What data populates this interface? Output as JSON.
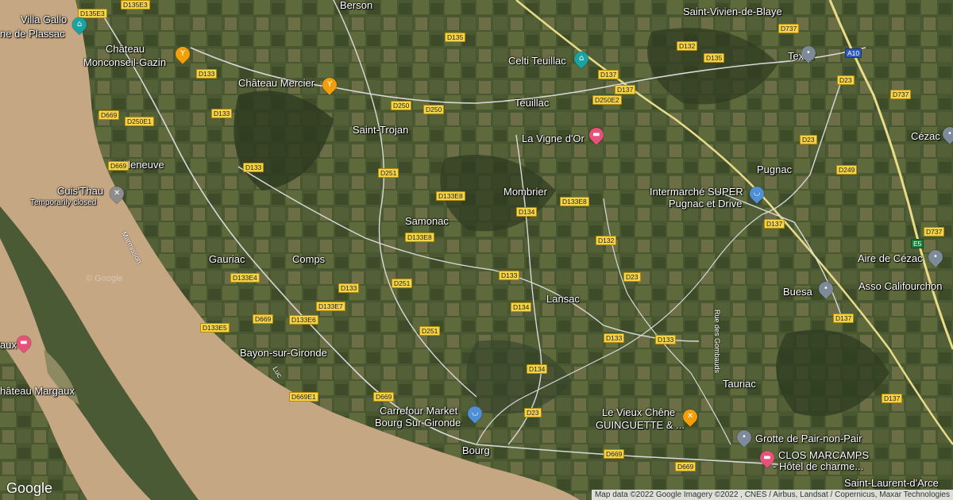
{
  "map": {
    "imagery": "satellite",
    "colors": {
      "river": "#c9aa86",
      "land": "#3f4e2c",
      "fields": "#6e7046",
      "road_major": "#e8dc8a",
      "road_minor": "#c8c8c8",
      "food_pin": "#f29f0a",
      "shop_pin": "#4f8fd6",
      "attraction_pin": "#1aa3a3",
      "hotel_pin": "#e8527a",
      "place_pin": "#7d8a99"
    }
  },
  "places": [
    {
      "text": "Villa Gallo",
      "cls": "place"
    },
    {
      "text": "ne de Plassac",
      "cls": "place"
    },
    {
      "text": "Saint-Vivien-de-Blaye",
      "cls": "place"
    },
    {
      "text": "Château",
      "cls": "place"
    },
    {
      "text": "Monconseil-Gazin",
      "cls": "place"
    },
    {
      "text": "Château Mercier",
      "cls": "place"
    },
    {
      "text": "Celti Teuillac",
      "cls": "place"
    },
    {
      "text": "Texier",
      "cls": "place"
    },
    {
      "text": "Teuillac",
      "cls": "place"
    },
    {
      "text": "Saint-Trojan",
      "cls": "place"
    },
    {
      "text": "La Vigne d'Or",
      "cls": "place"
    },
    {
      "text": "Cézac",
      "cls": "place"
    },
    {
      "text": "Villeneuve",
      "cls": "place"
    },
    {
      "text": "Pugnac",
      "cls": "place"
    },
    {
      "text": "Cuis'Thau",
      "cls": "place"
    },
    {
      "text": "Temporarily closed",
      "cls": "place small"
    },
    {
      "text": "Mombrier",
      "cls": "place"
    },
    {
      "text": "Intermarché SUPER",
      "cls": "place"
    },
    {
      "text": "Pugnac et Drive",
      "cls": "place"
    },
    {
      "text": "Samonac",
      "cls": "place"
    },
    {
      "text": "Gauriac",
      "cls": "place"
    },
    {
      "text": "Comps",
      "cls": "place"
    },
    {
      "text": "Aire de Cézac",
      "cls": "place"
    },
    {
      "text": "Asso Califourchon",
      "cls": "place"
    },
    {
      "text": "Buesa",
      "cls": "place"
    },
    {
      "text": "Lansac",
      "cls": "place"
    },
    {
      "text": "aux",
      "cls": "place"
    },
    {
      "text": "Bayon-sur-Gironde",
      "cls": "place"
    },
    {
      "text": "Tauriac",
      "cls": "place"
    },
    {
      "text": "hâteau Margaux",
      "cls": "place"
    },
    {
      "text": "Carrefour Market",
      "cls": "place"
    },
    {
      "text": "Bourg Sur Gironde",
      "cls": "place"
    },
    {
      "text": "Le Vieux Chêne",
      "cls": "place"
    },
    {
      "text": "GUINGUETTE & ...",
      "cls": "place"
    },
    {
      "text": "Grotte de Pair-non-Pair",
      "cls": "place"
    },
    {
      "text": "Bourg",
      "cls": "place"
    },
    {
      "text": "CLOS MARCAMPS",
      "cls": "place"
    },
    {
      "text": "- Hôtel de charme...",
      "cls": "place"
    },
    {
      "text": "Saint-Laurent-d'Arce",
      "cls": "place"
    },
    {
      "text": "Berson",
      "cls": "place"
    }
  ],
  "shields": [
    {
      "text": "D135E3"
    },
    {
      "text": "D135E3"
    },
    {
      "text": "D135"
    },
    {
      "text": "D737"
    },
    {
      "text": "D132"
    },
    {
      "text": "D135"
    },
    {
      "text": "A10",
      "cls": "shield blue"
    },
    {
      "text": "D133"
    },
    {
      "text": "D137"
    },
    {
      "text": "D137"
    },
    {
      "text": "D23"
    },
    {
      "text": "D669"
    },
    {
      "text": "D250E1"
    },
    {
      "text": "D133"
    },
    {
      "text": "D250"
    },
    {
      "text": "D250"
    },
    {
      "text": "D250E2"
    },
    {
      "text": "D737"
    },
    {
      "text": "D669"
    },
    {
      "text": "D133"
    },
    {
      "text": "D251"
    },
    {
      "text": "D23"
    },
    {
      "text": "D249"
    },
    {
      "text": "D133E8"
    },
    {
      "text": "D134"
    },
    {
      "text": "D133E8"
    },
    {
      "text": "D137"
    },
    {
      "text": "D133E8"
    },
    {
      "text": "D132"
    },
    {
      "text": "D737"
    },
    {
      "text": "E5",
      "cls": "shield green"
    },
    {
      "text": "D133E4"
    },
    {
      "text": "D133"
    },
    {
      "text": "D251"
    },
    {
      "text": "D133"
    },
    {
      "text": "D23"
    },
    {
      "text": "D133E7"
    },
    {
      "text": "D134"
    },
    {
      "text": "D669"
    },
    {
      "text": "D133E6"
    },
    {
      "text": "D137"
    },
    {
      "text": "D133E5"
    },
    {
      "text": "D251"
    },
    {
      "text": "D133"
    },
    {
      "text": "D133"
    },
    {
      "text": "D134"
    },
    {
      "text": "D669E1"
    },
    {
      "text": "D669"
    },
    {
      "text": "D137"
    },
    {
      "text": "D23"
    },
    {
      "text": "D669"
    },
    {
      "text": "D669"
    }
  ],
  "pins": [
    {
      "icon": "attraction-icon",
      "glyph": "⌂"
    },
    {
      "icon": "wine-icon",
      "glyph": "Y"
    },
    {
      "icon": "wine-icon",
      "glyph": "Y"
    },
    {
      "icon": "attraction-icon",
      "glyph": "⌂"
    },
    {
      "icon": "place-icon",
      "glyph": "•"
    },
    {
      "icon": "bed-icon",
      "glyph": "▬"
    },
    {
      "icon": "place-icon",
      "glyph": "•"
    },
    {
      "icon": "restaurant-icon",
      "glyph": "✕"
    },
    {
      "icon": "shopping-cart-icon",
      "glyph": "◡"
    },
    {
      "icon": "place-icon",
      "glyph": "•"
    },
    {
      "icon": "place-icon",
      "glyph": "•"
    },
    {
      "icon": "bed-icon",
      "glyph": "▬"
    },
    {
      "icon": "shopping-cart-icon",
      "glyph": "◡"
    },
    {
      "icon": "restaurant-icon",
      "glyph": "✕"
    },
    {
      "icon": "place-icon",
      "glyph": "•"
    },
    {
      "icon": "bed-icon",
      "glyph": "▬"
    }
  ],
  "road_labels": [
    {
      "text": "Marmisson"
    },
    {
      "text": "Rue des Gombauds"
    },
    {
      "text": "Luc"
    }
  ],
  "branding": {
    "logo": "Google",
    "watermark": "© Google",
    "attribution": "Map data ©2022 Google Imagery ©2022 , CNES / Airbus, Landsat / Copernicus, Maxar Technologies"
  }
}
